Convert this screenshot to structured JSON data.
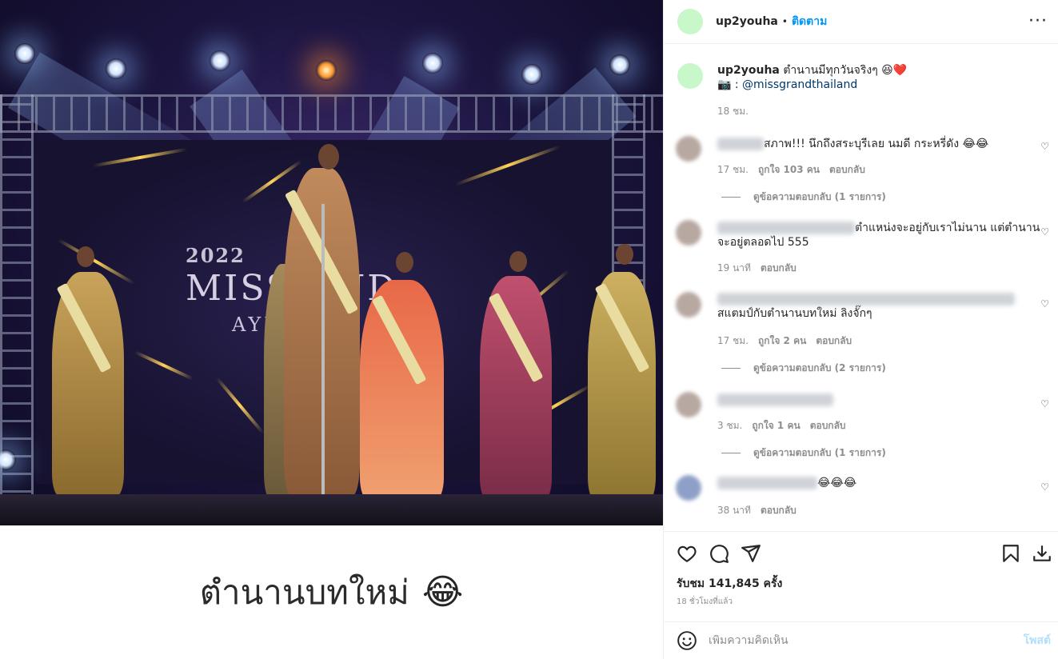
{
  "post": {
    "image_caption": "ตำนานบทใหม่",
    "image_caption_emoji": "😂",
    "screen_year": "2022",
    "screen_title": "MISS  AND",
    "screen_subtitle": "AYUT"
  },
  "header": {
    "username": "up2youha",
    "separator": "•",
    "follow_label": "ติดตาม",
    "more_label": "···"
  },
  "caption": {
    "username": "up2youha",
    "text": "ตำนานมีทุกวันจริงๆ 😆❤️",
    "camera": "📷",
    "tag": ": @missgrandthailand",
    "time": "18 ชม."
  },
  "comments": [
    {
      "text": "สภาพ!!! นึกถึงสระบุรีเลย นมดี กระหรี่ดัง 😂😂",
      "time": "17 ชม.",
      "likes": "ถูกใจ 103 คน",
      "reply": "ตอบกลับ",
      "view_replies": "ดูข้อความตอบกลับ (1 รายการ)"
    },
    {
      "text": "ตำแหน่งจะอยู่กับเราไม่นาน แต่ตำนาน",
      "text2": "จะอยู่ตลอดไป 555",
      "time": "19 นาที",
      "reply": "ตอบกลับ"
    },
    {
      "text": "สแตมป์กับตำนานบทใหม่ ลิงจั๊กๆ",
      "time": "17 ชม.",
      "likes": "ถูกใจ 2 คน",
      "reply": "ตอบกลับ",
      "view_replies": "ดูข้อความตอบกลับ (2 รายการ)"
    },
    {
      "time": "3 ชม.",
      "likes": "ถูกใจ 1 คน",
      "reply": "ตอบกลับ",
      "view_replies": "ดูข้อความตอบกลับ (1 รายการ)"
    },
    {
      "text": "😂😂😂",
      "time": "38 นาที",
      "reply": "ตอบกลับ"
    }
  ],
  "heart_glyph": "♡",
  "stats": {
    "views": "รับชม 141,845 ครั้ง",
    "ago": "18 ชั่วโมงที่แล้ว"
  },
  "add_comment": {
    "placeholder": "เพิ่มความคิดเห็น",
    "post_label": "โพสต์"
  },
  "icons": [
    "heart-icon",
    "comment-icon",
    "share-icon",
    "bookmark-icon",
    "download-icon",
    "emoji-icon"
  ],
  "colors": {
    "link": "#0095f6",
    "tag": "#00376b",
    "muted": "#8e8e8e",
    "post_disabled": "#b2dffc",
    "avatar": "#c8f7c9"
  }
}
